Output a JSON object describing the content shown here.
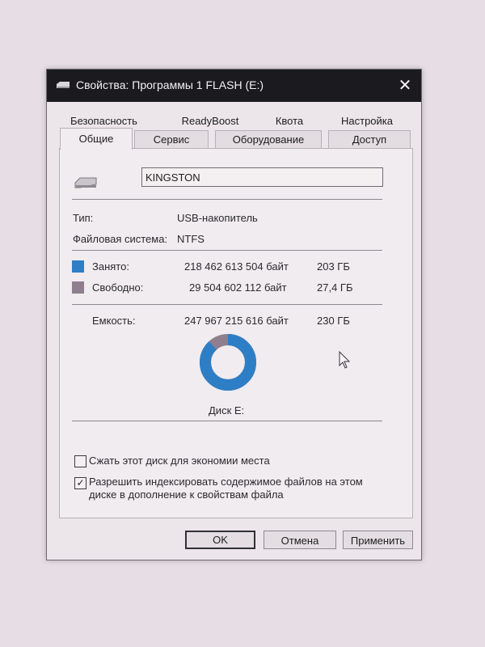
{
  "window": {
    "title": "Свойства: Программы 1 FLASH (E:)",
    "close_glyph": "✕"
  },
  "tabs": {
    "row1": [
      "Безопасность",
      "ReadyBoost",
      "Квота",
      "Настройка"
    ],
    "row2": [
      "Общие",
      "Сервис",
      "Оборудование",
      "Доступ"
    ],
    "active": "Общие"
  },
  "general": {
    "volume_label": "KINGSTON",
    "type_label": "Тип:",
    "type_value": "USB-накопитель",
    "fs_label": "Файловая система:",
    "fs_value": "NTFS",
    "used_label": "Занято:",
    "used_bytes": "218 462 613 504 байт",
    "used_size": "203 ГБ",
    "free_label": "Свободно:",
    "free_bytes": "29 504 602 112 байт",
    "free_size": "27,4 ГБ",
    "capacity_label": "Емкость:",
    "capacity_bytes": "247 967 215 616 байт",
    "capacity_size": "230 ГБ",
    "disk_label": "Диск E:",
    "used_fraction": 0.881,
    "colors": {
      "used": "#2e7ec6",
      "free": "#8f7f8e"
    }
  },
  "options": {
    "compress_label": "Сжать этот диск для экономии места",
    "compress_checked": false,
    "index_label_line1": "Разрешить индексировать содержимое файлов на этом",
    "index_label_line2": "диске в дополнение к свойствам файла",
    "index_checked": true,
    "check_glyph": "✓"
  },
  "buttons": {
    "ok": "OK",
    "cancel": "Отмена",
    "apply": "Применить"
  }
}
